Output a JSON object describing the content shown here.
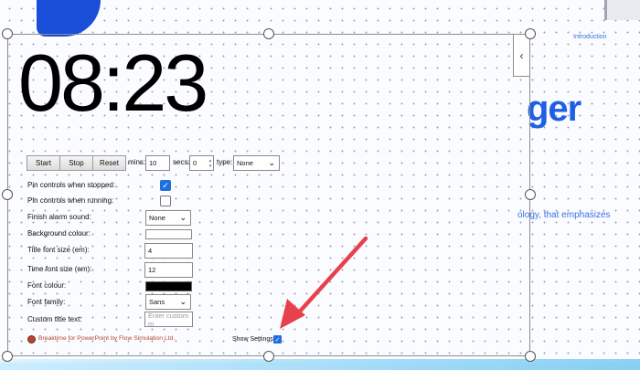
{
  "slide": {
    "intro": "Introduction",
    "heading_fragment": "ger",
    "body_fragment": "ology, that emphasizes"
  },
  "timer": {
    "display": "08:23"
  },
  "controls": {
    "start_label": "Start",
    "stop_label": "Stop",
    "reset_label": "Reset",
    "mins_label": "mins:",
    "mins_value": "10",
    "secs_label": "secs:",
    "secs_value": "0",
    "type_label": "type:",
    "type_value": "None"
  },
  "settings": {
    "pin_stopped_label": "Pin controls when stopped:",
    "pin_stopped_checked": true,
    "pin_running_label": "Pin controls when running:",
    "pin_running_checked": false,
    "alarm_label": "Finish alarm sound:",
    "alarm_value": "None",
    "bg_colour_label": "Background colour:",
    "bg_colour": "#ffffff",
    "title_size_label": "Title font size (em):",
    "title_size_value": "4",
    "time_size_label": "Time font size (em):",
    "time_size_value": "12",
    "font_colour_label": "Font colour:",
    "font_colour": "#000000",
    "font_family_label": "Font family:",
    "font_family_value": "Sans",
    "custom_title_label": "Custom title text:",
    "custom_title_placeholder": "Enter custom m"
  },
  "footer": {
    "credit": "Breaktime for PowerPoint by Flow Simulation Ltd.",
    "show_settings_label": "Show Settings",
    "show_settings_checked": true
  },
  "colors": {
    "accent_blue": "#1f5ee6",
    "arrow_red": "#e8414e",
    "credit_red": "#b4462c"
  }
}
